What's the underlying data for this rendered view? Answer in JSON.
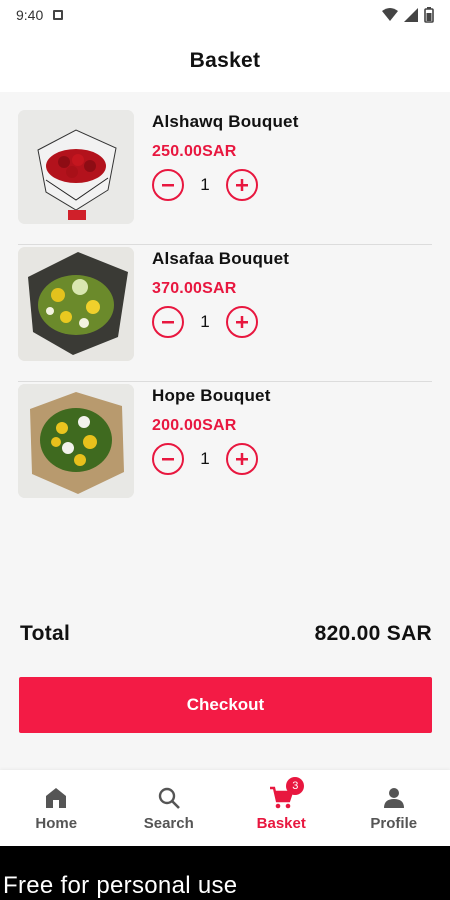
{
  "status_bar": {
    "time": "9:40"
  },
  "header": {
    "title": "Basket"
  },
  "items": [
    {
      "name": "Alshawq Bouquet",
      "price": "250.00SAR",
      "quantity": "1"
    },
    {
      "name": "Alsafaa Bouquet",
      "price": "370.00SAR",
      "quantity": "1"
    },
    {
      "name": "Hope Bouquet",
      "price": "200.00SAR",
      "quantity": "1"
    }
  ],
  "summary": {
    "total_label": "Total",
    "total_value": "820.00 SAR"
  },
  "checkout": {
    "label": "Checkout"
  },
  "bottom_nav": {
    "items": [
      {
        "label": "Home",
        "icon": "home-icon"
      },
      {
        "label": "Search",
        "icon": "search-icon"
      },
      {
        "label": "Basket",
        "icon": "cart-icon",
        "badge": "3",
        "active": true
      },
      {
        "label": "Profile",
        "icon": "person-icon"
      }
    ]
  },
  "watermark": "Free for personal use",
  "colors": {
    "accent": "#e8173f",
    "checkout_bg": "#f31b45"
  }
}
